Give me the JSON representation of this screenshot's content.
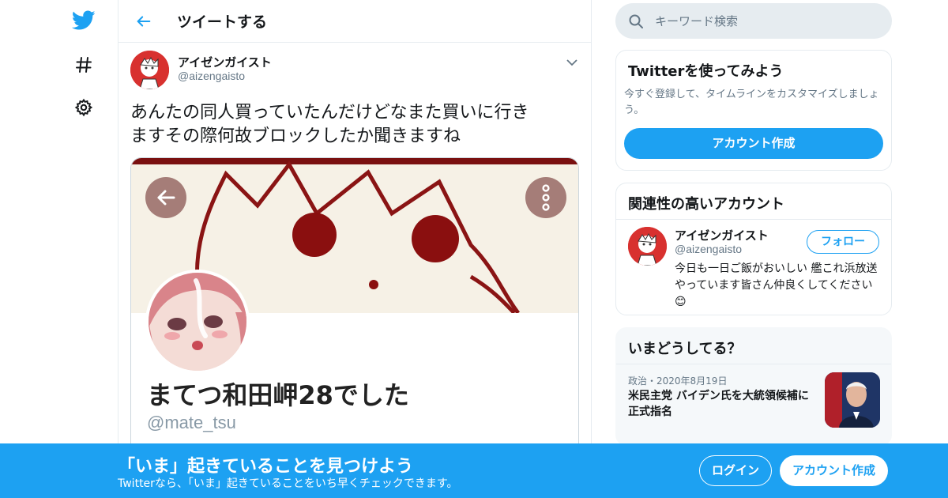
{
  "nav": {
    "icons": [
      "twitter-logo-icon",
      "hashtag-icon",
      "settings-gear-icon"
    ]
  },
  "header": {
    "title": "ツイートする"
  },
  "tweet": {
    "author_name": "アイゼンガイスト",
    "author_handle": "@aizengaisto",
    "text_line1": "あんたの同人買っていたんだけどなまた買いに行き",
    "text_line2": "ますその際何故ブロックしたか聞きますね",
    "media": {
      "profile_name": "まてつ和田岬28でした",
      "profile_handle": "@mate_tsu"
    }
  },
  "search": {
    "placeholder": "キーワード検索"
  },
  "signup_card": {
    "title": "Twitterを使ってみよう",
    "text": "今すぐ登録して、タイムラインをカスタマイズしましょう。",
    "button": "アカウント作成"
  },
  "related_card": {
    "title": "関連性の高いアカウント",
    "name": "アイゼンガイスト",
    "handle": "@aizengaisto",
    "follow_button": "フォロー",
    "bio": "今日も一日ご飯がおいしい 艦これ浜放送やっています皆さん仲良くしてください😊"
  },
  "trends_card": {
    "title": "いまどうしてる？",
    "item_meta": "政治・2020年8月19日",
    "item_title": "米民主党 バイデン氏を大統領候補に正式指名"
  },
  "bottom_bar": {
    "title": "「いま」起きていることを見つけよう",
    "subtitle": "Twitterなら、「いま」起きていることをいち早くチェックできます。",
    "login_button": "ログイン",
    "signup_button": "アカウント作成"
  },
  "colors": {
    "accent": "#1da1f2",
    "border": "#e6ecf0",
    "muted_text": "#657786"
  }
}
